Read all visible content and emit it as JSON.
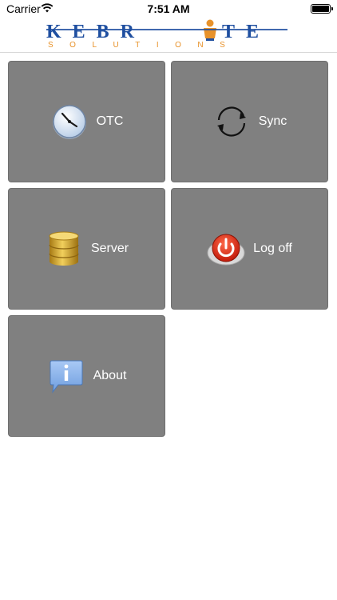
{
  "status_bar": {
    "carrier": "Carrier",
    "time": "7:51 AM",
    "battery_level": 1.0
  },
  "header": {
    "logo_name": "KEBRITE",
    "logo_tagline": "SOLUTIONS",
    "brand_blue": "#1f4fa0",
    "brand_orange": "#e8922a"
  },
  "tiles": [
    {
      "label": "OTC",
      "icon": "clock-icon"
    },
    {
      "label": "Sync",
      "icon": "sync-icon"
    },
    {
      "label": "Server",
      "icon": "database-icon"
    },
    {
      "label": "Log off",
      "icon": "power-icon"
    },
    {
      "label": "About",
      "icon": "info-icon"
    }
  ],
  "colors": {
    "tile_background": "#808080",
    "tile_text": "#ffffff"
  }
}
